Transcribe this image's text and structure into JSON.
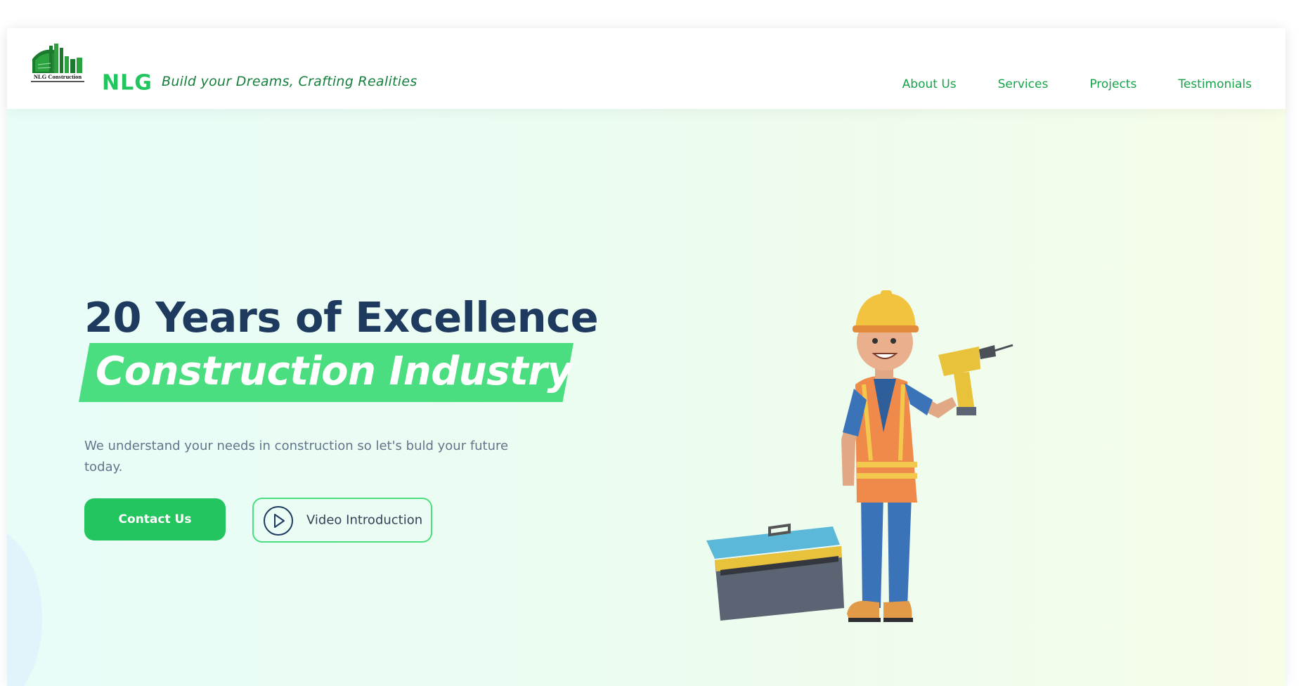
{
  "header": {
    "logo_text": "NLG Construction",
    "brand": "NLG",
    "tagline": "Build your Dreams, Crafting Realities",
    "nav": [
      {
        "label": "About Us"
      },
      {
        "label": "Services"
      },
      {
        "label": "Projects"
      },
      {
        "label": "Testimonials"
      }
    ]
  },
  "hero": {
    "headline_line1": "20 Years of Excellence",
    "headline_line2": "Construction Industry",
    "subtext": "We understand your needs in construction so let's buld your future today.",
    "primary_button": "Contact Us",
    "secondary_button": "Video Introduction",
    "illustration": "construction-worker-with-drill-and-toolbox"
  },
  "icons": {
    "play": "play-circle-icon",
    "logo": "building-logo-icon"
  },
  "colors": {
    "brand_green": "#22c55e",
    "headline_navy": "#1e3a5f",
    "highlight_green": "#4ade80",
    "tagline_green": "#15803d"
  }
}
